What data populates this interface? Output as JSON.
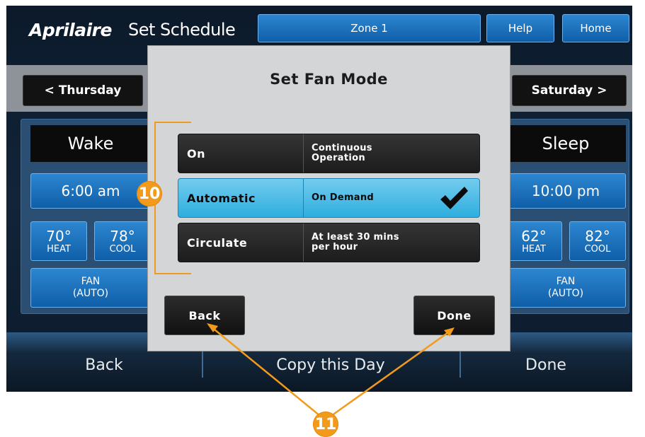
{
  "header": {
    "brand": "Aprilaire",
    "screen_title": "Set Schedule",
    "zone_label": "Zone 1",
    "help_label": "Help",
    "home_label": "Home"
  },
  "days": {
    "previous": "< Thursday",
    "next": "Saturday >"
  },
  "wake": {
    "label": "Wake",
    "time": "6:00 am",
    "heat": "70°",
    "heat_label": "HEAT",
    "cool": "78°",
    "cool_label": "COOL",
    "fan_line1": "FAN",
    "fan_line2": "(AUTO)"
  },
  "sleep": {
    "label": "Sleep",
    "time": "10:00 pm",
    "heat": "62°",
    "heat_label": "HEAT",
    "cool": "82°",
    "cool_label": "COOL",
    "fan_line1": "FAN",
    "fan_line2": "(AUTO)"
  },
  "footer": {
    "back": "Back",
    "copy": "Copy this Day",
    "done": "Done"
  },
  "dialog": {
    "title": "Set Fan Mode",
    "options": [
      {
        "name": "On",
        "desc_line1": "Continuous",
        "desc_line2": "Operation",
        "selected": false
      },
      {
        "name": "Automatic",
        "desc_line1": "On Demand",
        "desc_line2": "",
        "selected": true
      },
      {
        "name": "Circulate",
        "desc_line1": "At least 30 mins",
        "desc_line2": "per hour",
        "selected": false
      }
    ],
    "back_label": "Back",
    "done_label": "Done"
  },
  "callouts": {
    "options": "10",
    "buttons": "11"
  },
  "colors": {
    "accent_blue": "#1f73bf",
    "selected_option": "#4bbde8",
    "callout_orange": "#f29a1c",
    "dialog_bg": "#d4d5d6"
  }
}
